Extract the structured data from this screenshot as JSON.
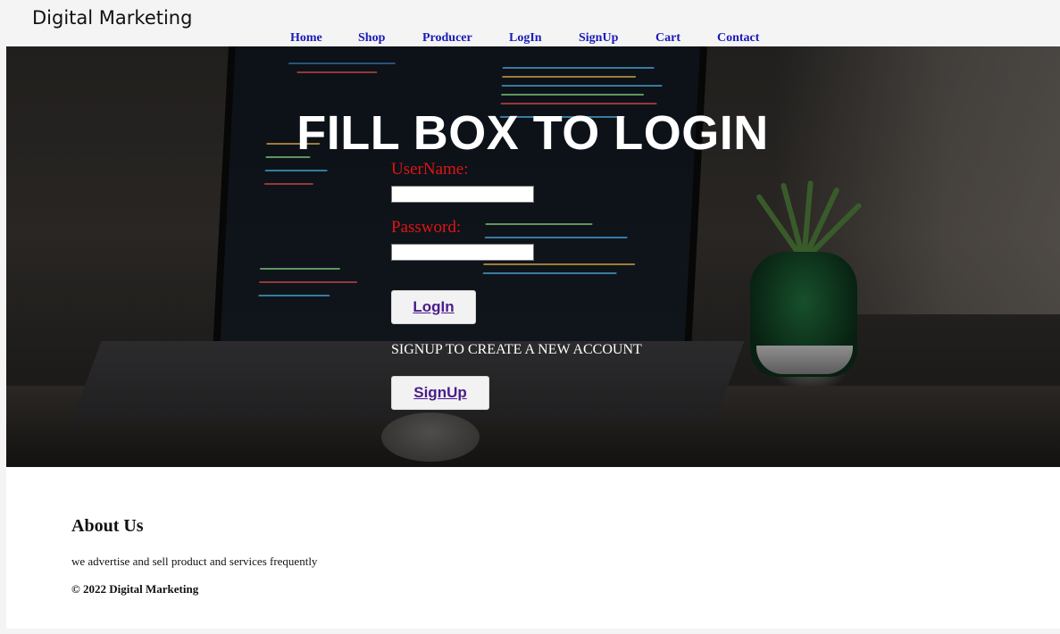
{
  "brand": {
    "name": "Digital Marketing"
  },
  "nav": {
    "items": [
      {
        "label": "Home"
      },
      {
        "label": "Shop"
      },
      {
        "label": "Producer"
      },
      {
        "label": "LogIn"
      },
      {
        "label": "SignUp"
      },
      {
        "label": "Cart"
      },
      {
        "label": "Contact"
      }
    ],
    "link_color": "#1a1ab8"
  },
  "login": {
    "heading": "FILL BOX TO LOGIN",
    "username_label": "UserName:",
    "username_value": "",
    "password_label": "Password:",
    "password_value": "",
    "login_button": "LogIn",
    "signup_prompt": "SIGNUP TO CREATE A NEW ACCOUNT",
    "signup_button": "SignUp",
    "label_color": "#e01414"
  },
  "footer": {
    "about_title": "About Us",
    "about_text": "we advertise and sell product and services frequently",
    "copyright": "© 2022 Digital Marketing"
  }
}
